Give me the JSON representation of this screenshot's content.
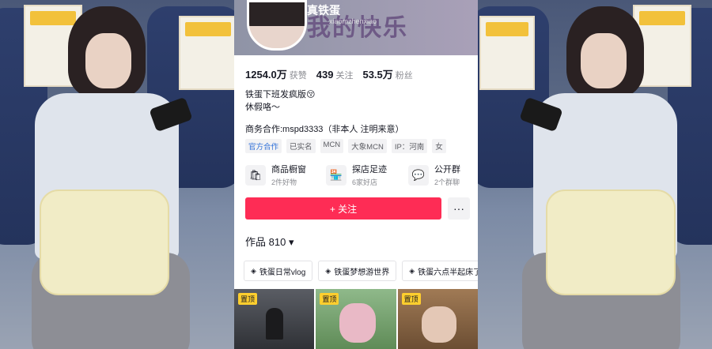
{
  "profile": {
    "nickname": "真铁蛋",
    "douyin_id": "xiaomzhenxiao",
    "banner_text": "我的快乐",
    "stats": [
      {
        "value": "1254.0万",
        "label": "获赞"
      },
      {
        "value": "439",
        "label": "关注"
      },
      {
        "value": "53.5万",
        "label": "粉丝"
      }
    ],
    "bio_line1": "铁蛋下班发疯版😚",
    "bio_line2": "休假咯～",
    "business": "商务合作:mspd3333（非本人 注明来意）",
    "tags": [
      "官方合作",
      "已实名",
      "MCN",
      "大象MCN",
      "IP：河南",
      "女"
    ]
  },
  "services": [
    {
      "icon": "shop-icon",
      "glyph": "🛍",
      "title": "商品橱窗",
      "sub": "2件好物"
    },
    {
      "icon": "store-icon",
      "glyph": "🏪",
      "title": "探店足迹",
      "sub": "6家好店"
    },
    {
      "icon": "chat-icon",
      "glyph": "💬",
      "title": "公开群",
      "sub": "2个群聊"
    }
  ],
  "actions": {
    "follow_label": "+ 关注",
    "more_label": "···"
  },
  "works": {
    "label": "作品",
    "count": "810",
    "caret": "▾"
  },
  "collections": [
    "铁蛋日常vlog",
    "铁蛋梦想游世界",
    "铁蛋六点半起床了"
  ],
  "thumbnails": [
    {
      "pin": "置顶"
    },
    {
      "pin": "置顶"
    },
    {
      "pin": "置顶"
    }
  ],
  "colors": {
    "accent": "#fe2c55",
    "pin": "#fece2e",
    "text": "#161823",
    "muted": "#8a8b91"
  }
}
